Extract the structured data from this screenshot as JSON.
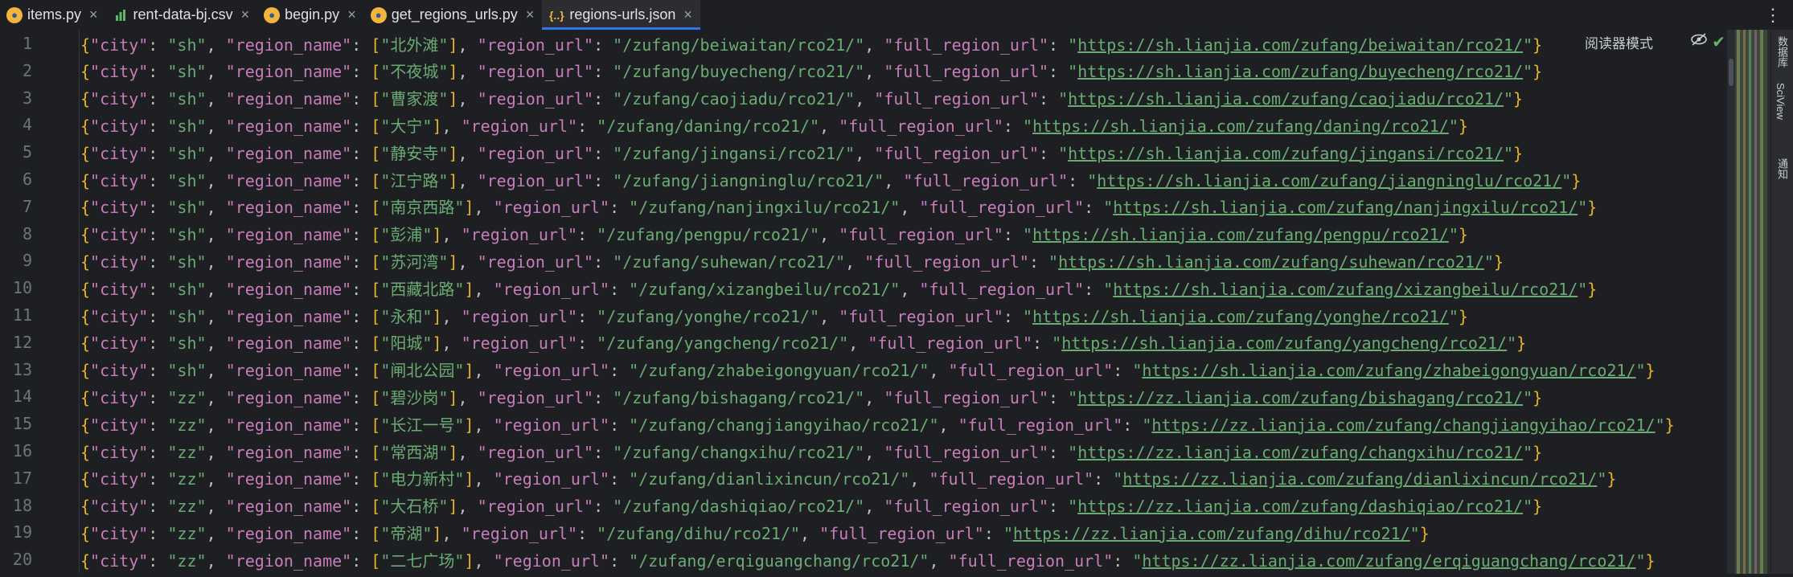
{
  "tabs": [
    {
      "label": "items.py",
      "icon": "python-icon",
      "active": false
    },
    {
      "label": "rent-data-bj.csv",
      "icon": "csv-chart-icon",
      "active": false
    },
    {
      "label": "begin.py",
      "icon": "python-icon",
      "active": false
    },
    {
      "label": "get_regions_urls.py",
      "icon": "python-icon",
      "active": false
    },
    {
      "label": "regions-urls.json",
      "icon": "json-icon",
      "active": true
    }
  ],
  "toolbar": {
    "reader_mode": "阅读器模式"
  },
  "right_tools": [
    "数据库",
    "SciView",
    "通知"
  ],
  "keys": {
    "city": "\"city\"",
    "region_name": "\"region_name\"",
    "region_url": "\"region_url\"",
    "full_region_url": "\"full_region_url\""
  },
  "lines": [
    {
      "n": "1",
      "city": "\"sh\"",
      "name": "\"北外滩\"",
      "url": "\"/zufang/beiwaitan/rco21/\"",
      "full": "https://sh.lianjia.com/zufang/beiwaitan/rco21/"
    },
    {
      "n": "2",
      "city": "\"sh\"",
      "name": "\"不夜城\"",
      "url": "\"/zufang/buyecheng/rco21/\"",
      "full": "https://sh.lianjia.com/zufang/buyecheng/rco21/"
    },
    {
      "n": "3",
      "city": "\"sh\"",
      "name": "\"曹家渡\"",
      "url": "\"/zufang/caojiadu/rco21/\"",
      "full": "https://sh.lianjia.com/zufang/caojiadu/rco21/"
    },
    {
      "n": "4",
      "city": "\"sh\"",
      "name": "\"大宁\"",
      "url": "\"/zufang/daning/rco21/\"",
      "full": "https://sh.lianjia.com/zufang/daning/rco21/"
    },
    {
      "n": "5",
      "city": "\"sh\"",
      "name": "\"静安寺\"",
      "url": "\"/zufang/jingansi/rco21/\"",
      "full": "https://sh.lianjia.com/zufang/jingansi/rco21/"
    },
    {
      "n": "6",
      "city": "\"sh\"",
      "name": "\"江宁路\"",
      "url": "\"/zufang/jiangninglu/rco21/\"",
      "full": "https://sh.lianjia.com/zufang/jiangninglu/rco21/"
    },
    {
      "n": "7",
      "city": "\"sh\"",
      "name": "\"南京西路\"",
      "url": "\"/zufang/nanjingxilu/rco21/\"",
      "full": "https://sh.lianjia.com/zufang/nanjingxilu/rco21/"
    },
    {
      "n": "8",
      "city": "\"sh\"",
      "name": "\"彭浦\"",
      "url": "\"/zufang/pengpu/rco21/\"",
      "full": "https://sh.lianjia.com/zufang/pengpu/rco21/"
    },
    {
      "n": "9",
      "city": "\"sh\"",
      "name": "\"苏河湾\"",
      "url": "\"/zufang/suhewan/rco21/\"",
      "full": "https://sh.lianjia.com/zufang/suhewan/rco21/"
    },
    {
      "n": "10",
      "city": "\"sh\"",
      "name": "\"西藏北路\"",
      "url": "\"/zufang/xizangbeilu/rco21/\"",
      "full": "https://sh.lianjia.com/zufang/xizangbeilu/rco21/"
    },
    {
      "n": "11",
      "city": "\"sh\"",
      "name": "\"永和\"",
      "url": "\"/zufang/yonghe/rco21/\"",
      "full": "https://sh.lianjia.com/zufang/yonghe/rco21/"
    },
    {
      "n": "12",
      "city": "\"sh\"",
      "name": "\"阳城\"",
      "url": "\"/zufang/yangcheng/rco21/\"",
      "full": "https://sh.lianjia.com/zufang/yangcheng/rco21/"
    },
    {
      "n": "13",
      "city": "\"sh\"",
      "name": "\"闸北公园\"",
      "url": "\"/zufang/zhabeigongyuan/rco21/\"",
      "full": "https://sh.lianjia.com/zufang/zhabeigongyuan/rco21/"
    },
    {
      "n": "14",
      "city": "\"zz\"",
      "name": "\"碧沙岗\"",
      "url": "\"/zufang/bishagang/rco21/\"",
      "full": "https://zz.lianjia.com/zufang/bishagang/rco21/"
    },
    {
      "n": "15",
      "city": "\"zz\"",
      "name": "\"长江一号\"",
      "url": "\"/zufang/changjiangyihao/rco21/\"",
      "full": "https://zz.lianjia.com/zufang/changjiangyihao/rco21/"
    },
    {
      "n": "16",
      "city": "\"zz\"",
      "name": "\"常西湖\"",
      "url": "\"/zufang/changxihu/rco21/\"",
      "full": "https://zz.lianjia.com/zufang/changxihu/rco21/"
    },
    {
      "n": "17",
      "city": "\"zz\"",
      "name": "\"电力新村\"",
      "url": "\"/zufang/dianlixincun/rco21/\"",
      "full": "https://zz.lianjia.com/zufang/dianlixincun/rco21/"
    },
    {
      "n": "18",
      "city": "\"zz\"",
      "name": "\"大石桥\"",
      "url": "\"/zufang/dashiqiao/rco21/\"",
      "full": "https://zz.lianjia.com/zufang/dashiqiao/rco21/"
    },
    {
      "n": "19",
      "city": "\"zz\"",
      "name": "\"帝湖\"",
      "url": "\"/zufang/dihu/rco21/\"",
      "full": "https://zz.lianjia.com/zufang/dihu/rco21/"
    },
    {
      "n": "20",
      "city": "\"zz\"",
      "name": "\"二七广场\"",
      "url": "\"/zufang/erqiguangchang/rco21/\"",
      "full": "https://zz.lianjia.com/zufang/erqiguangchang/rco21/"
    }
  ]
}
